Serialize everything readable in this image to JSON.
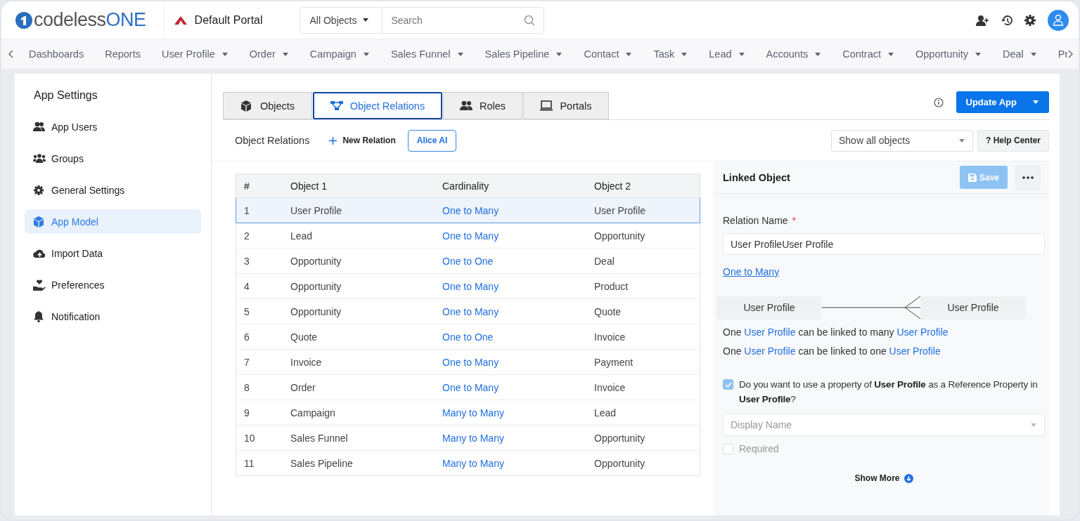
{
  "header": {
    "logo": {
      "prefix": "codeless",
      "suffix": "ONE"
    },
    "portal": "Default Portal",
    "search_scope": "All Objects",
    "search": {
      "placeholder": "Search"
    }
  },
  "nav": {
    "items": [
      {
        "label": "Dashboards",
        "dropdown": false
      },
      {
        "label": "Reports",
        "dropdown": false
      },
      {
        "label": "User Profile",
        "dropdown": true
      },
      {
        "label": "Order",
        "dropdown": true
      },
      {
        "label": "Campaign",
        "dropdown": true
      },
      {
        "label": "Sales Funnel",
        "dropdown": true
      },
      {
        "label": "Sales Pipeline",
        "dropdown": true
      },
      {
        "label": "Contact",
        "dropdown": true
      },
      {
        "label": "Task",
        "dropdown": true
      },
      {
        "label": "Lead",
        "dropdown": true
      },
      {
        "label": "Accounts",
        "dropdown": true
      },
      {
        "label": "Contract",
        "dropdown": true
      },
      {
        "label": "Opportunity",
        "dropdown": true
      },
      {
        "label": "Deal",
        "dropdown": true
      },
      {
        "label": "Pr",
        "dropdown": false
      }
    ]
  },
  "sidebar": {
    "title": "App Settings",
    "items": [
      {
        "label": "App Users",
        "selected": false
      },
      {
        "label": "Groups",
        "selected": false
      },
      {
        "label": "General Settings",
        "selected": false
      },
      {
        "label": "App Model",
        "selected": true
      },
      {
        "label": "Import Data",
        "selected": false
      },
      {
        "label": "Preferences",
        "selected": false
      },
      {
        "label": "Notification",
        "selected": false
      }
    ]
  },
  "tabs": [
    {
      "label": "Objects",
      "selected": false
    },
    {
      "label": "Object Relations",
      "selected": true
    },
    {
      "label": "Roles",
      "selected": false
    },
    {
      "label": "Portals",
      "selected": false
    }
  ],
  "update_button": "Update App",
  "toolbar": {
    "title": "Object Relations",
    "new_button": "New Relation",
    "ai_button": "Alice AI",
    "filter": "Show all objects",
    "help": "? Help Center"
  },
  "table": {
    "columns": [
      "#",
      "Object 1",
      "Cardinality",
      "Object 2"
    ],
    "rows": [
      {
        "cells": [
          "1",
          "User Profile",
          "One to Many",
          "User Profile"
        ],
        "selected": true
      },
      {
        "cells": [
          "2",
          "Lead",
          "One to Many",
          "Opportunity"
        ],
        "selected": false
      },
      {
        "cells": [
          "3",
          "Opportunity",
          "One to One",
          "Deal"
        ],
        "selected": false
      },
      {
        "cells": [
          "4",
          "Opportunity",
          "One to Many",
          "Product"
        ],
        "selected": false
      },
      {
        "cells": [
          "5",
          "Opportunity",
          "One to Many",
          "Quote"
        ],
        "selected": false
      },
      {
        "cells": [
          "6",
          "Quote",
          "One to One",
          "Invoice"
        ],
        "selected": false
      },
      {
        "cells": [
          "7",
          "Invoice",
          "One to Many",
          "Payment"
        ],
        "selected": false
      },
      {
        "cells": [
          "8",
          "Order",
          "One to Many",
          "Invoice"
        ],
        "selected": false
      },
      {
        "cells": [
          "9",
          "Campaign",
          "Many to Many",
          "Lead"
        ],
        "selected": false
      },
      {
        "cells": [
          "10",
          "Sales Funnel",
          "Many to Many",
          "Opportunity"
        ],
        "selected": false
      },
      {
        "cells": [
          "11",
          "Sales Pipeline",
          "Many to Many",
          "Opportunity"
        ],
        "selected": false
      }
    ]
  },
  "detail": {
    "title": "Linked Object",
    "save": "Save",
    "field_label": "Relation Name",
    "required_mark": "*",
    "field_value": "User ProfileUser Profile",
    "cardinality_link": "One to Many",
    "diagram": {
      "left": "User Profile",
      "right": "User Profile"
    },
    "sentences": [
      {
        "parts": [
          "One ",
          "User Profile",
          " can be linked to many ",
          "User Profile"
        ]
      },
      {
        "parts": [
          "One ",
          "User Profile",
          " can be linked to one ",
          "User Profile"
        ]
      }
    ],
    "reference": {
      "checked": true,
      "text": "Do you want to use a property of **User Profile** as a Reference Property in **User Profile**?"
    },
    "display_name": {
      "placeholder": "Display Name"
    },
    "required": {
      "label": "Required",
      "checked": false
    },
    "show_more": "Show More"
  }
}
